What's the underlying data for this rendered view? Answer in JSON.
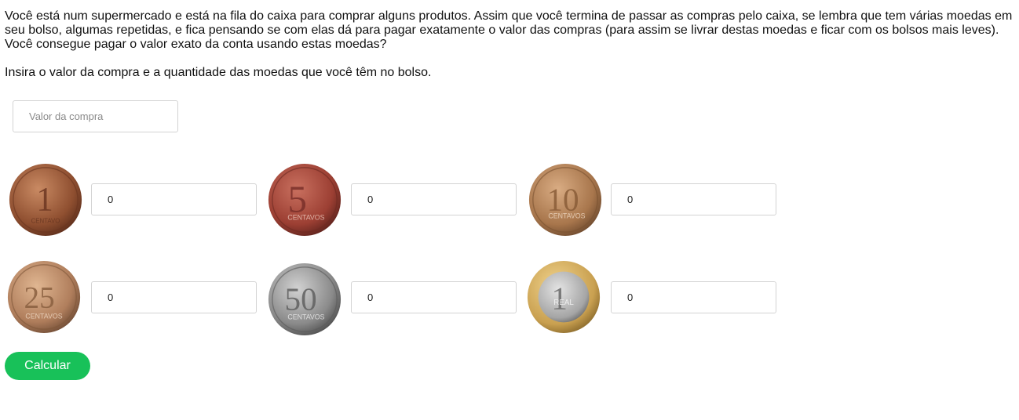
{
  "intro_text": "Você está num supermercado e está na fila do caixa para comprar alguns produtos. Assim que você termina de passar as compras pelo caixa, se lembra que tem várias moedas em seu bolso, algumas repetidas, e fica pensando se com elas dá para pagar exatamente o valor das compras (para assim se livrar destas moedas e ficar com os bolsos mais leves). Você consegue pagar o valor exato da conta usando estas moedas?",
  "instruction_text": "Insira o valor da compra e a quantidade das moedas que você têm no bolso.",
  "valor_compra": {
    "placeholder": "Valor da compra",
    "value": ""
  },
  "coins": [
    {
      "label": "1",
      "unit": "CENTAVO",
      "quantity": "0",
      "color": "#9a5a38"
    },
    {
      "label": "5",
      "unit": "CENTAVOS",
      "quantity": "0",
      "color": "#a8483c"
    },
    {
      "label": "10",
      "unit": "CENTAVOS",
      "quantity": "0",
      "color": "#b08055"
    },
    {
      "label": "25",
      "unit": "CENTAVOS",
      "quantity": "0",
      "color": "#b9845f"
    },
    {
      "label": "50",
      "unit": "CENTAVOS",
      "quantity": "0",
      "color": "#8f8f8f"
    },
    {
      "label": "1",
      "unit": "REAL",
      "quantity": "0",
      "color": "#d8b060"
    }
  ],
  "calcular_label": "Calcular",
  "colors": {
    "accent": "#18c159",
    "border": "#d3d3d3"
  }
}
